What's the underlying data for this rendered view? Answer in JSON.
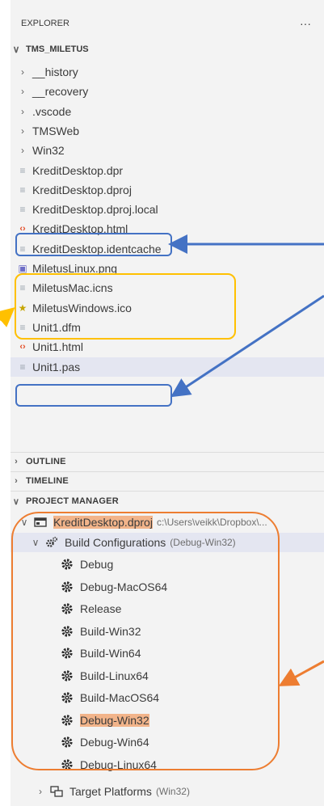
{
  "explorer": {
    "title": "EXPLORER",
    "more": "···",
    "root": "TMS_MILETUS",
    "items": [
      {
        "label": "__history",
        "kind": "folder"
      },
      {
        "label": "__recovery",
        "kind": "folder"
      },
      {
        "label": ".vscode",
        "kind": "folder"
      },
      {
        "label": "TMSWeb",
        "kind": "folder"
      },
      {
        "label": "Win32",
        "kind": "folder"
      },
      {
        "label": "KreditDesktop.dpr",
        "kind": "text"
      },
      {
        "label": "KreditDesktop.dproj",
        "kind": "text"
      },
      {
        "label": "KreditDesktop.dproj.local",
        "kind": "text"
      },
      {
        "label": "KreditDesktop.html",
        "kind": "html"
      },
      {
        "label": "KreditDesktop.identcache",
        "kind": "text"
      },
      {
        "label": "MiletusLinux.png",
        "kind": "image"
      },
      {
        "label": "MiletusMac.icns",
        "kind": "text"
      },
      {
        "label": "MiletusWindows.ico",
        "kind": "star"
      },
      {
        "label": "Unit1.dfm",
        "kind": "text"
      },
      {
        "label": "Unit1.html",
        "kind": "html"
      },
      {
        "label": "Unit1.pas",
        "kind": "text"
      }
    ]
  },
  "sections": {
    "outline": "OUTLINE",
    "timeline": "TIMELINE",
    "project_manager": "PROJECT MANAGER"
  },
  "project": {
    "name": "KreditDesktop.dproj",
    "path": "c:\\Users\\veikk\\Dropbox\\...",
    "build_configs_label": "Build Configurations",
    "build_configs_active": "(Debug-Win32)",
    "configs": [
      "Debug",
      "Debug-MacOS64",
      "Release",
      "Build-Win32",
      "Build-Win64",
      "Build-Linux64",
      "Build-MacOS64",
      "Debug-Win32",
      "Debug-Win64",
      "Debug-Linux64"
    ],
    "target_platforms_label": "Target Platforms",
    "target_platforms_value": "(Win32)"
  },
  "icons": {
    "folder_chevron": "chevron-right-icon",
    "expanded_chevron": "chevron-down-icon",
    "text_file": "file-lines-icon",
    "html_file": "code-brackets-icon",
    "image_file": "image-icon",
    "ico_file": "star-icon",
    "project": "project-icon",
    "build_config": "gear-icon",
    "target_platforms": "platforms-icon"
  },
  "colors": {
    "sidebar_bg": "#f3f3f3",
    "selected_row": "#e4e6f1",
    "highlight": "#f2b48a",
    "callout_blue": "#4472c4",
    "callout_yellow": "#ffc000",
    "callout_orange": "#ed7d31"
  }
}
